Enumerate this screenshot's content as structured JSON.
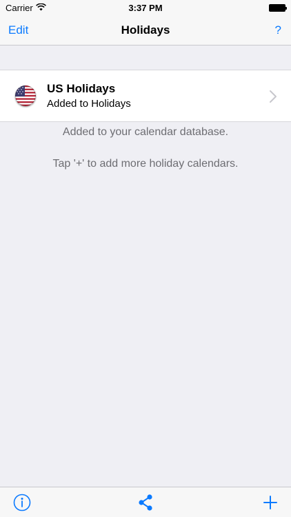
{
  "status_bar": {
    "carrier": "Carrier",
    "time": "3:37 PM"
  },
  "nav": {
    "edit_label": "Edit",
    "title": "Holidays",
    "help_label": "?"
  },
  "holiday_row": {
    "title": "US Holidays",
    "subtitle": "Added to Holidays",
    "flag_icon": "us-flag-icon"
  },
  "info": {
    "line1": "Added to your calendar database.",
    "line2": "Tap '+' to add more holiday calendars."
  },
  "toolbar": {
    "left_icon": "info-icon",
    "center_icon": "share-icon",
    "right_icon": "add-icon"
  },
  "colors": {
    "accent": "#0a7aff",
    "background": "#efeff4",
    "secondary_text": "#6d6d72"
  }
}
